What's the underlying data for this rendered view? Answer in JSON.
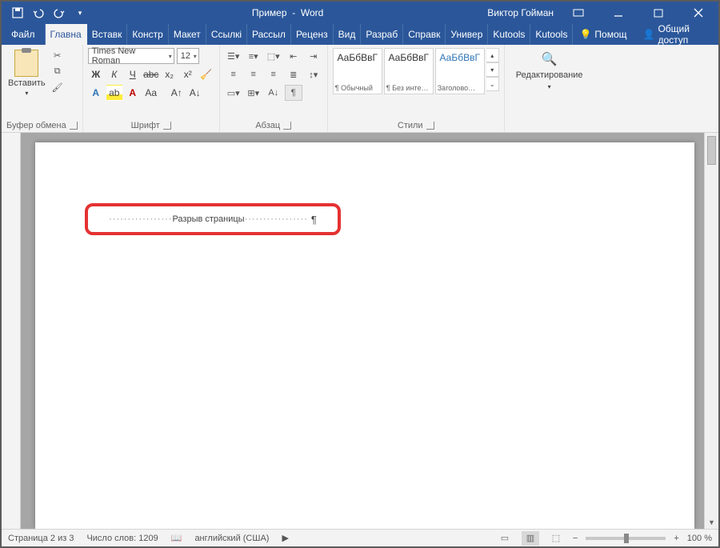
{
  "title": {
    "doc": "Пример",
    "app": "Word",
    "user": "Виктор Гойман"
  },
  "tabs": {
    "file": "Файл",
    "items": [
      "Главна",
      "Вставк",
      "Констр",
      "Макет",
      "Ссылкі",
      "Рассыл",
      "Реценз",
      "Вид",
      "Разраб",
      "Справк",
      "Универ",
      "Kutools",
      "Kutools"
    ],
    "help": "Помощ",
    "share": "Общий доступ"
  },
  "clipboard": {
    "paste": "Вставить",
    "label": "Буфер обмена"
  },
  "font": {
    "name": "Times New Roman",
    "size": "12",
    "label": "Шрифт"
  },
  "paragraph": {
    "label": "Абзац"
  },
  "styles": {
    "label": "Стили",
    "preview": "АаБбВвГ",
    "items": [
      "¶ Обычный",
      "¶ Без инте…",
      "Заголово…"
    ]
  },
  "editing": {
    "label": "Редактирование"
  },
  "page_break": "Разрыв страницы",
  "status": {
    "page": "Страница 2 из 3",
    "words": "Число слов: 1209",
    "lang": "английский (США)",
    "zoom": "100 %"
  }
}
